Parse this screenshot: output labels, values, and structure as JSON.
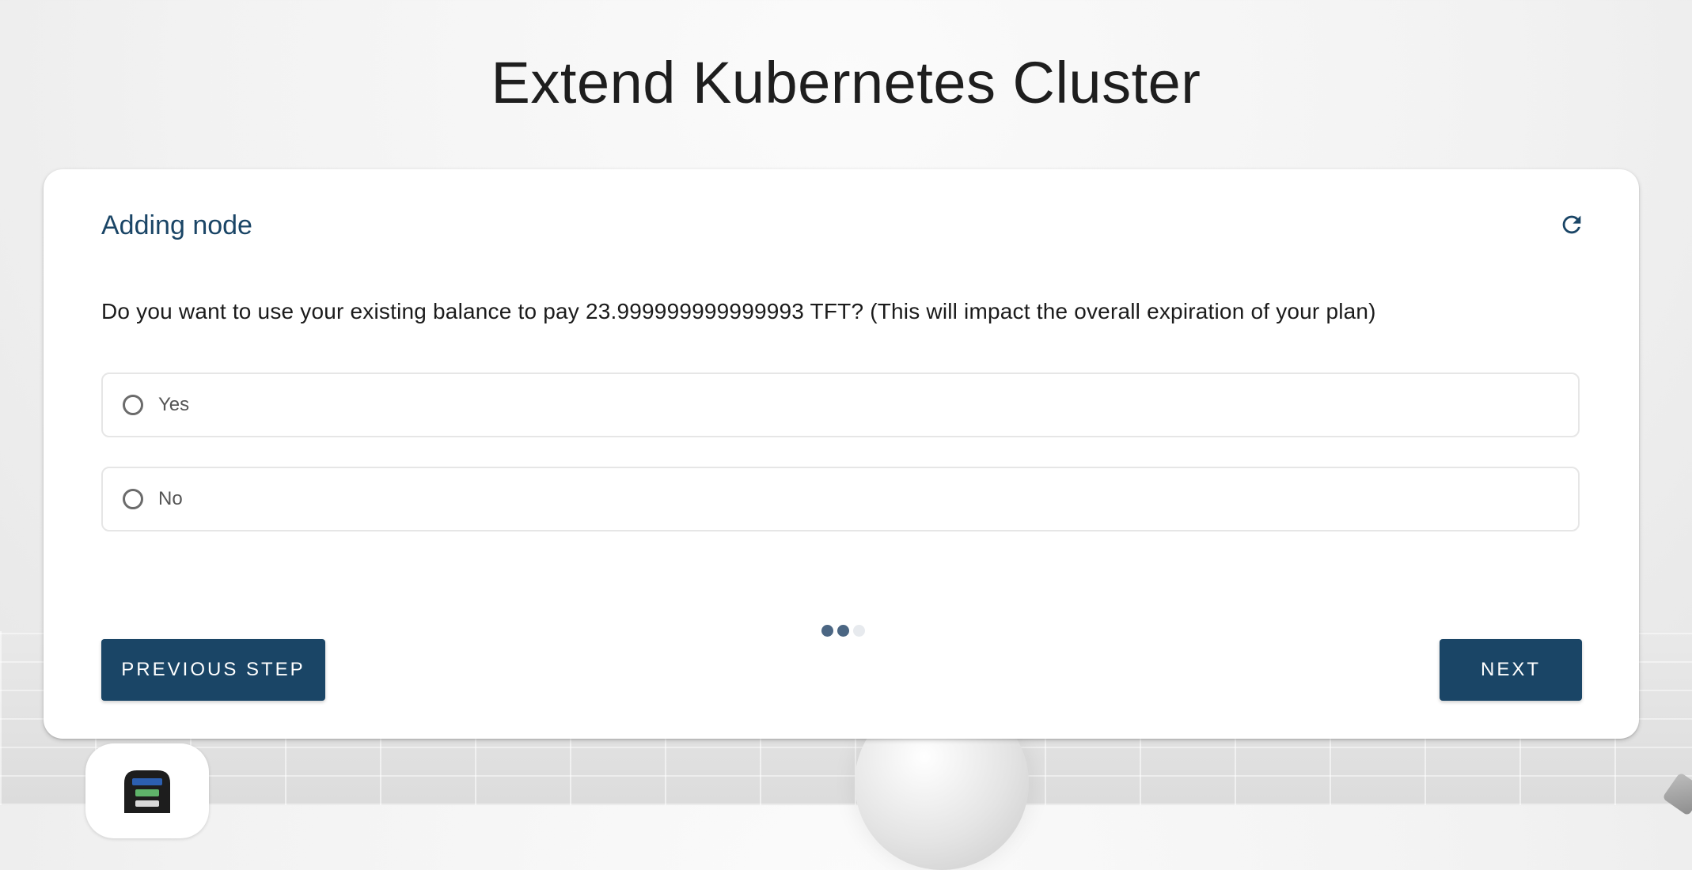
{
  "page": {
    "title": "Extend Kubernetes Cluster"
  },
  "card": {
    "title": "Adding node",
    "refresh_icon": "refresh-icon",
    "question": "Do you want to use your existing balance to pay 23.999999999999993 TFT? (This will impact the overall expiration of your plan)",
    "options": [
      {
        "label": "Yes",
        "selected": false
      },
      {
        "label": "No",
        "selected": false
      }
    ],
    "steps": {
      "total": 3,
      "completed": 2
    },
    "buttons": {
      "previous": "Previous Step",
      "next": "Next"
    }
  },
  "colors": {
    "primary": "#1a4566",
    "active_dot": "#4b6683",
    "inactive_dot": "#e7eaee"
  }
}
